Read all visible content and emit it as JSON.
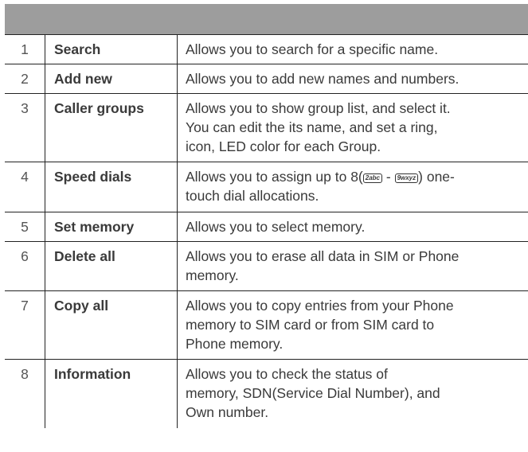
{
  "rows": [
    {
      "num": "1",
      "title": "Search",
      "desc": "Allows you to search for a specific name."
    },
    {
      "num": "2",
      "title": "Add new",
      "desc": "Allows you to add new names and numbers."
    },
    {
      "num": "3",
      "title": "Caller groups",
      "desc_lines": [
        "Allows you to show group list, and select it.",
        "You can edit the its name, and set a ring,",
        "icon, LED color for each Group."
      ]
    },
    {
      "num": "4",
      "title": "Speed dials",
      "desc_pre": "Allows you to assign up to 8(",
      "key_a": "2abc",
      "desc_mid": " - ",
      "key_b": "9wxyz",
      "desc_post": ") one-",
      "desc_line2": "touch dial allocations."
    },
    {
      "num": "5",
      "title": "Set memory",
      "desc": "Allows you to select memory."
    },
    {
      "num": "6",
      "title": "Delete all",
      "desc_lines": [
        "Allows you to erase all data in SIM or Phone",
        "memory."
      ]
    },
    {
      "num": "7",
      "title": "Copy all",
      "desc_lines": [
        "Allows you to copy entries from your Phone",
        "memory to SIM card or from SIM card to",
        "Phone memory."
      ]
    },
    {
      "num": "8",
      "title": "Information",
      "desc_lines": [
        "Allows you to check the status of",
        "memory, SDN(Service Dial Number), and",
        "Own number."
      ]
    }
  ]
}
